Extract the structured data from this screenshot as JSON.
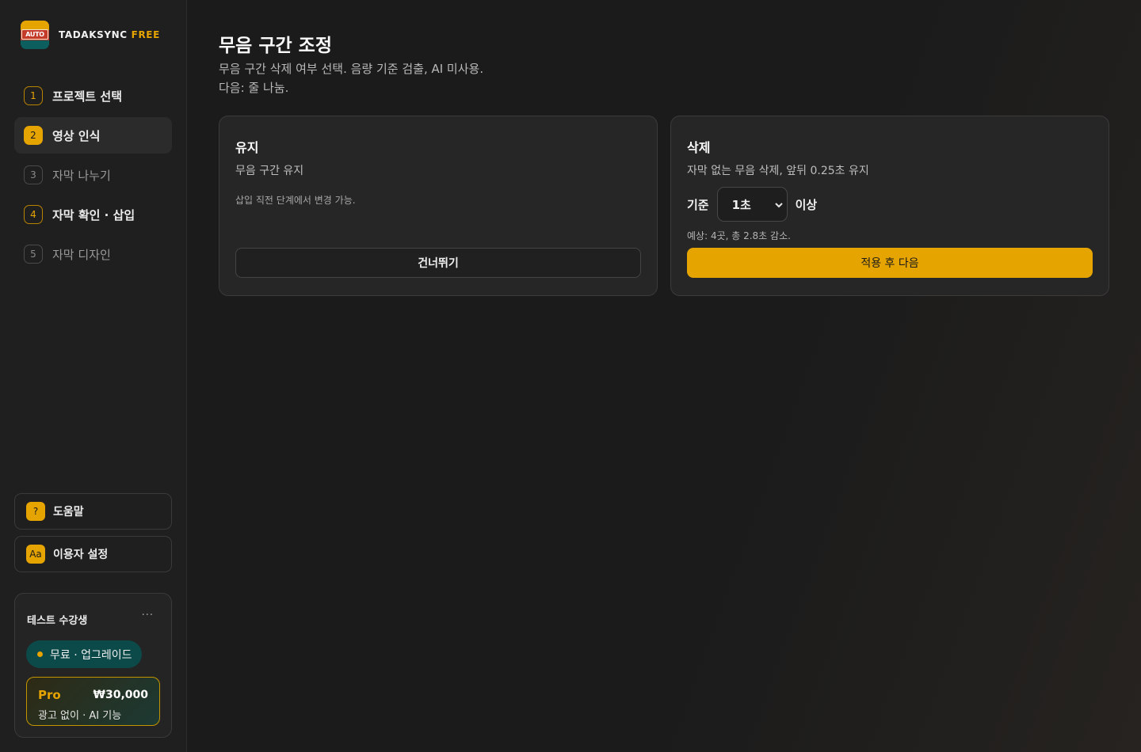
{
  "brand": {
    "logo_text": "AUTO",
    "name": "TADAKSYNC",
    "tier": "FREE"
  },
  "sidebar": {
    "steps": [
      {
        "num": "1",
        "label": "프로젝트 선택"
      },
      {
        "num": "2",
        "label": "영상 인식"
      },
      {
        "num": "3",
        "label": "자막 나누기"
      },
      {
        "num": "4",
        "label": "자막 확인 · 삽입"
      },
      {
        "num": "5",
        "label": "자막 디자인"
      }
    ],
    "help": {
      "icon": "?",
      "label": "도움말"
    },
    "settings": {
      "icon": "Aa",
      "label": "이용자 설정"
    }
  },
  "user": {
    "name": "테스트 수강생",
    "more": "···",
    "plan": "무료 · 업그레이드",
    "pro": {
      "title": "Pro",
      "price": "₩30,000",
      "desc": "광고 없이 · AI 기능"
    }
  },
  "main": {
    "title": "무음 구간 조정",
    "subtitle_1": "무음 구간 삭제 여부 선택. 음량 기준 검출, AI 미사용.",
    "subtitle_2": "다음: 줄 나눔."
  },
  "keep_card": {
    "title": "유지",
    "desc": "무음 구간 유지",
    "note": "삽입 직전 단계에서 변경 가능.",
    "button": "건너뛰기"
  },
  "delete_card": {
    "title": "삭제",
    "desc": "자막 없는 무음 삭제, 앞뒤 0.25초 유지",
    "criteria_label": "기준",
    "criteria_value": "1초",
    "criteria_suffix": "이상",
    "estimate": "예상: 4곳, 총 2.8초 감소.",
    "button": "적용 후 다음"
  },
  "colors": {
    "accent": "#e6a400",
    "teal": "#0c4a4a",
    "background": "#1c1c1c"
  }
}
